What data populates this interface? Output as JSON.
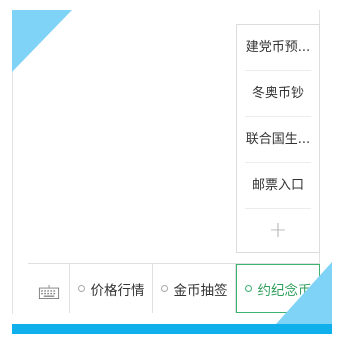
{
  "colors": {
    "accent_blue": "#0fb0ec",
    "corner_blue": "#7fd3f7",
    "active_green": "#3cb371"
  },
  "menu": {
    "items": [
      {
        "label": "建党币预..."
      },
      {
        "label": "冬奥币钞"
      },
      {
        "label": "联合国生..."
      },
      {
        "label": "邮票入口"
      }
    ],
    "add_icon": "plus-icon"
  },
  "tabbar": {
    "keyboard_icon": "keyboard-icon",
    "tabs": [
      {
        "label": "价格行情",
        "active": false
      },
      {
        "label": "金币抽签",
        "active": false
      },
      {
        "label": "约纪念币",
        "active": true
      }
    ]
  }
}
